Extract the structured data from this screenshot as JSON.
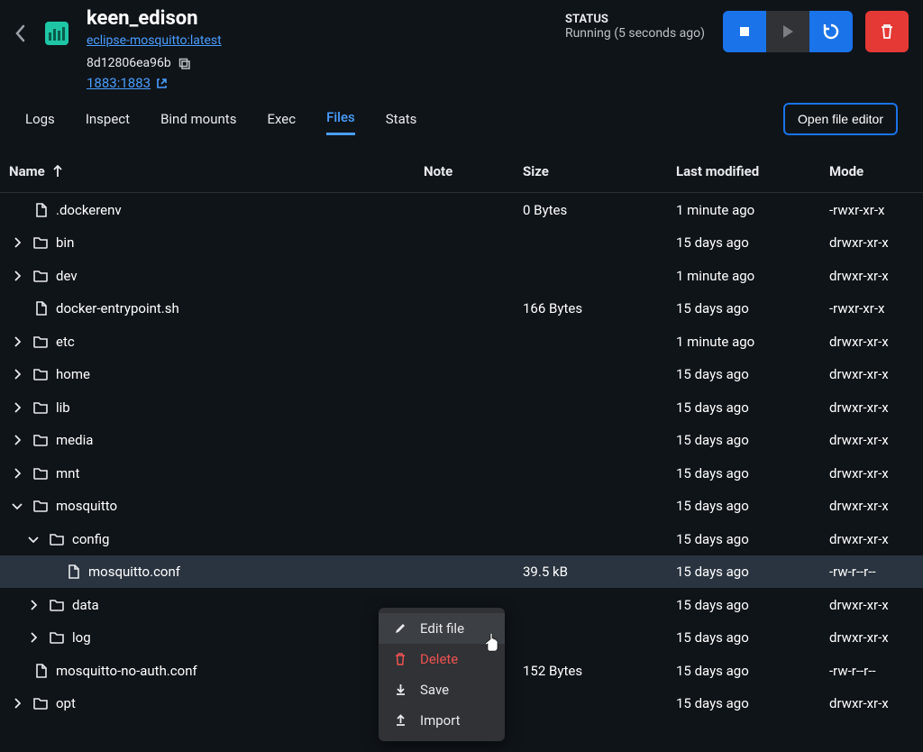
{
  "header": {
    "title": "keen_edison",
    "image": "eclipse-mosquitto:latest",
    "container_id": "8d12806ea96b",
    "port": "1883:1883",
    "status_label": "STATUS",
    "status_text": "Running (5 seconds ago)"
  },
  "tabs": {
    "logs": "Logs",
    "inspect": "Inspect",
    "bind_mounts": "Bind mounts",
    "exec": "Exec",
    "files": "Files",
    "stats": "Stats",
    "open_editor": "Open file editor"
  },
  "columns": {
    "name": "Name",
    "note": "Note",
    "size": "Size",
    "modified": "Last modified",
    "mode": "Mode"
  },
  "rows": [
    {
      "name": ".dockerenv",
      "type": "file",
      "indent": 0,
      "chev": "",
      "size": "0 Bytes",
      "modified": "1 minute ago",
      "mode": "-rwxr-xr-x"
    },
    {
      "name": "bin",
      "type": "dir",
      "indent": 0,
      "chev": "right",
      "size": "",
      "modified": "15 days ago",
      "mode": "drwxr-xr-x"
    },
    {
      "name": "dev",
      "type": "dir",
      "indent": 0,
      "chev": "right",
      "size": "",
      "modified": "1 minute ago",
      "mode": "drwxr-xr-x"
    },
    {
      "name": "docker-entrypoint.sh",
      "type": "file",
      "indent": 0,
      "chev": "",
      "size": "166 Bytes",
      "modified": "15 days ago",
      "mode": "-rwxr-xr-x"
    },
    {
      "name": "etc",
      "type": "dir",
      "indent": 0,
      "chev": "right",
      "size": "",
      "modified": "1 minute ago",
      "mode": "drwxr-xr-x"
    },
    {
      "name": "home",
      "type": "dir",
      "indent": 0,
      "chev": "right",
      "size": "",
      "modified": "15 days ago",
      "mode": "drwxr-xr-x"
    },
    {
      "name": "lib",
      "type": "dir",
      "indent": 0,
      "chev": "right",
      "size": "",
      "modified": "15 days ago",
      "mode": "drwxr-xr-x"
    },
    {
      "name": "media",
      "type": "dir",
      "indent": 0,
      "chev": "right",
      "size": "",
      "modified": "15 days ago",
      "mode": "drwxr-xr-x"
    },
    {
      "name": "mnt",
      "type": "dir",
      "indent": 0,
      "chev": "right",
      "size": "",
      "modified": "15 days ago",
      "mode": "drwxr-xr-x"
    },
    {
      "name": "mosquitto",
      "type": "dir",
      "indent": 0,
      "chev": "down",
      "size": "",
      "modified": "15 days ago",
      "mode": "drwxr-xr-x"
    },
    {
      "name": "config",
      "type": "dir",
      "indent": 1,
      "chev": "down",
      "size": "",
      "modified": "15 days ago",
      "mode": "drwxr-xr-x"
    },
    {
      "name": "mosquitto.conf",
      "type": "file",
      "indent": 2,
      "chev": "",
      "size": "39.5 kB",
      "modified": "15 days ago",
      "mode": "-rw-r--r--",
      "selected": true
    },
    {
      "name": "data",
      "type": "dir",
      "indent": 1,
      "chev": "right",
      "size": "",
      "modified": "15 days ago",
      "mode": "drwxr-xr-x"
    },
    {
      "name": "log",
      "type": "dir",
      "indent": 1,
      "chev": "right",
      "size": "",
      "modified": "15 days ago",
      "mode": "drwxr-xr-x"
    },
    {
      "name": "mosquitto-no-auth.conf",
      "type": "file",
      "indent": 0,
      "chev": "",
      "size": "152 Bytes",
      "modified": "15 days ago",
      "mode": "-rw-r--r--"
    },
    {
      "name": "opt",
      "type": "dir",
      "indent": 0,
      "chev": "right",
      "size": "",
      "modified": "15 days ago",
      "mode": "drwxr-xr-x"
    }
  ],
  "context_menu": {
    "edit": "Edit file",
    "delete": "Delete",
    "save": "Save",
    "import": "Import"
  }
}
